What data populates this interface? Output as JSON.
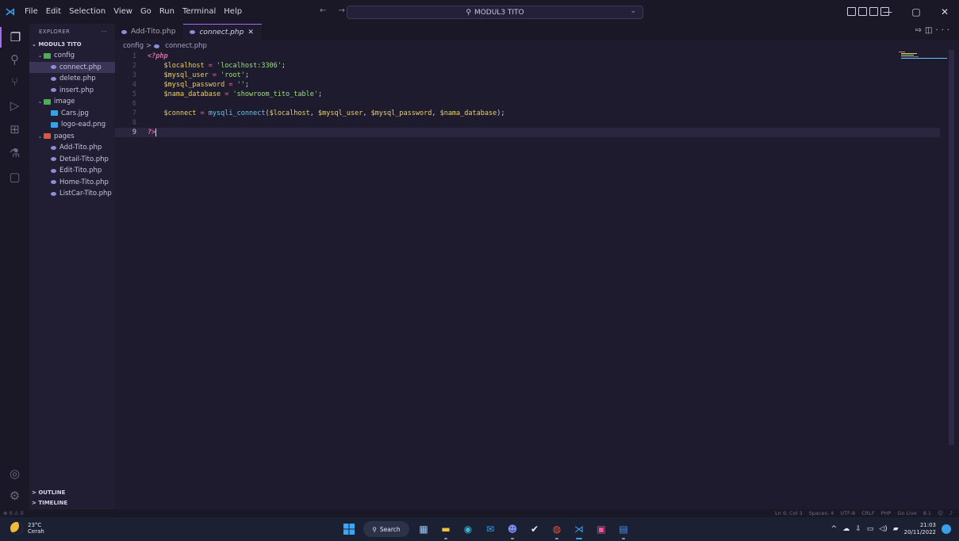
{
  "window": {
    "menu": [
      "File",
      "Edit",
      "Selection",
      "View",
      "Go",
      "Run",
      "Terminal",
      "Help"
    ],
    "nav_arrows": "← →",
    "search_label": "MODUL3 TITO",
    "controls": {
      "minimize": "—",
      "maximize": "▢",
      "close": "✕"
    }
  },
  "activity_bar": [
    "explorer-icon",
    "search-icon",
    "source-control-icon",
    "run-debug-icon",
    "extensions-icon",
    "testing-icon",
    "remote-explorer-icon",
    "account-icon",
    "settings-gear-icon"
  ],
  "sidebar": {
    "title": "EXPLORER",
    "more": "···",
    "root": "MODUL3 TITO",
    "tree": [
      {
        "label": "config",
        "type": "folder",
        "depth": 0,
        "color": "#4caf50"
      },
      {
        "label": "connect.php",
        "type": "php",
        "depth": 1,
        "selected": true
      },
      {
        "label": "delete.php",
        "type": "php",
        "depth": 1
      },
      {
        "label": "insert.php",
        "type": "php",
        "depth": 1
      },
      {
        "label": "image",
        "type": "folder",
        "depth": 0,
        "color": "#4caf50"
      },
      {
        "label": "Cars.jpg",
        "type": "image",
        "depth": 1
      },
      {
        "label": "logo-ead.png",
        "type": "image",
        "depth": 1
      },
      {
        "label": "pages",
        "type": "folder",
        "depth": 0,
        "color": "#e0573e"
      },
      {
        "label": "Add-Tito.php",
        "type": "php",
        "depth": 1
      },
      {
        "label": "Detail-Tito.php",
        "type": "php",
        "depth": 1
      },
      {
        "label": "Edit-Tito.php",
        "type": "php",
        "depth": 1
      },
      {
        "label": "Home-Tito.php",
        "type": "php",
        "depth": 1
      },
      {
        "label": "ListCar-Tito.php",
        "type": "php",
        "depth": 1
      }
    ],
    "outline": "OUTLINE",
    "timeline": "TIMELINE"
  },
  "tabs": [
    {
      "label": "Add-Tito.php",
      "active": false
    },
    {
      "label": "connect.php",
      "active": true,
      "close": "✕"
    }
  ],
  "breadcrumb": {
    "folder": "config",
    "sep": ">",
    "file": "connect.php"
  },
  "editor": {
    "current_line": 9,
    "lines": [
      {
        "n": "1",
        "tokens": [
          [
            "kw",
            "<?php"
          ]
        ]
      },
      {
        "n": "2",
        "tokens": [
          [
            "sp",
            "    "
          ],
          [
            "var",
            "$localhost"
          ],
          [
            "op",
            " = "
          ],
          [
            "str",
            "'localhost:3306'"
          ],
          [
            "punc",
            ";"
          ]
        ]
      },
      {
        "n": "3",
        "tokens": [
          [
            "sp",
            "    "
          ],
          [
            "var",
            "$mysql_user"
          ],
          [
            "op",
            " = "
          ],
          [
            "str",
            "'root'"
          ],
          [
            "punc",
            ";"
          ]
        ]
      },
      {
        "n": "4",
        "tokens": [
          [
            "sp",
            "    "
          ],
          [
            "var",
            "$mysql_password"
          ],
          [
            "op",
            " = "
          ],
          [
            "str",
            "''"
          ],
          [
            "punc",
            ";"
          ]
        ]
      },
      {
        "n": "5",
        "tokens": [
          [
            "sp",
            "    "
          ],
          [
            "var",
            "$nama_database"
          ],
          [
            "op",
            " = "
          ],
          [
            "str",
            "'showroom_tito_table'"
          ],
          [
            "punc",
            ";"
          ]
        ]
      },
      {
        "n": "6",
        "tokens": []
      },
      {
        "n": "7",
        "tokens": [
          [
            "sp",
            "    "
          ],
          [
            "var",
            "$connect"
          ],
          [
            "op",
            " = "
          ],
          [
            "fn",
            "mysqli_connect"
          ],
          [
            "punc",
            "("
          ],
          [
            "var",
            "$localhost"
          ],
          [
            "punc",
            ", "
          ],
          [
            "var",
            "$mysql_user"
          ],
          [
            "punc",
            ", "
          ],
          [
            "var",
            "$mysql_password"
          ],
          [
            "punc",
            ", "
          ],
          [
            "var",
            "$nama_database"
          ],
          [
            "punc",
            ");"
          ]
        ]
      },
      {
        "n": "8",
        "tokens": []
      },
      {
        "n": "9",
        "tokens": [
          [
            "kw",
            "?>"
          ]
        ]
      }
    ]
  },
  "status_bar": {
    "left": "⊗ 0 ⚠ 0",
    "right": [
      "Ln 9, Col 3",
      "Spaces: 4",
      "UTF-8",
      "CRLF",
      "PHP",
      "Go Live",
      "8.1"
    ]
  },
  "taskbar": {
    "weather_temp": "23°C",
    "weather_desc": "Cerah",
    "search": "Search",
    "apps": [
      "file-explorer-icon",
      "files-folder-icon",
      "edge-browser-icon",
      "mail-icon",
      "discord-icon",
      "check-app-icon",
      "chrome-icon",
      "vscode-icon",
      "office-icon",
      "word-icon"
    ],
    "tray_chevron": "^",
    "time": "21:03",
    "date": "20/11/2022"
  }
}
